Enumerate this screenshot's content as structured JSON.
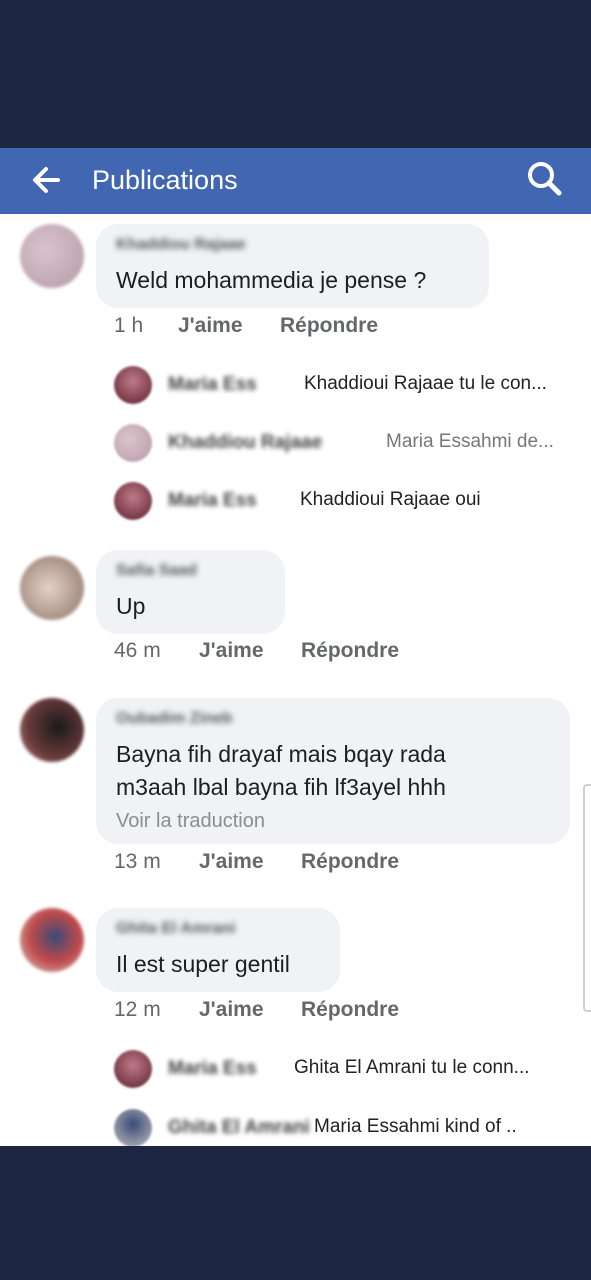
{
  "header": {
    "title": "Publications",
    "back_icon": "arrow-left-icon",
    "search_icon": "search-icon"
  },
  "comments": [
    {
      "author": "Khaddiou Rajaae",
      "text": "Weld mohammedia je pense ?",
      "time": "1 h",
      "like": "J'aime",
      "reply": "Répondre"
    },
    {
      "author": "Safia Saad",
      "text": "Up",
      "time": "46 m",
      "like": "J'aime",
      "reply": "Répondre"
    },
    {
      "author": "Oubadim Zineb",
      "text": "Bayna fih drayaf mais bqay rada",
      "text2": "m3aah lbal bayna fih lf3ayel hhh",
      "translate": "Voir la traduction",
      "time": "13 m",
      "like": "J'aime",
      "reply": "Répondre"
    },
    {
      "author": "Ghita El Amrani",
      "text": "Il est super gentil",
      "time": "12 m",
      "like": "J'aime",
      "reply": "Répondre"
    }
  ],
  "replies": [
    {
      "name": "Maria Ess",
      "text": "Khaddioui Rajaae tu le con..."
    },
    {
      "name": "Khaddiou Rajaae",
      "text": "Maria Essahmi de..."
    },
    {
      "name": "Maria Ess",
      "text": "Khaddioui Rajaae oui"
    },
    {
      "name": "Maria Ess",
      "text": "Ghita El Amrani tu le conn..."
    },
    {
      "name": "Ghita El Amrani",
      "text": "Maria Essahmi kind of .."
    }
  ],
  "colors": {
    "header": "#4267b2",
    "frame": "#1c2541",
    "bubble": "#f0f2f5"
  }
}
